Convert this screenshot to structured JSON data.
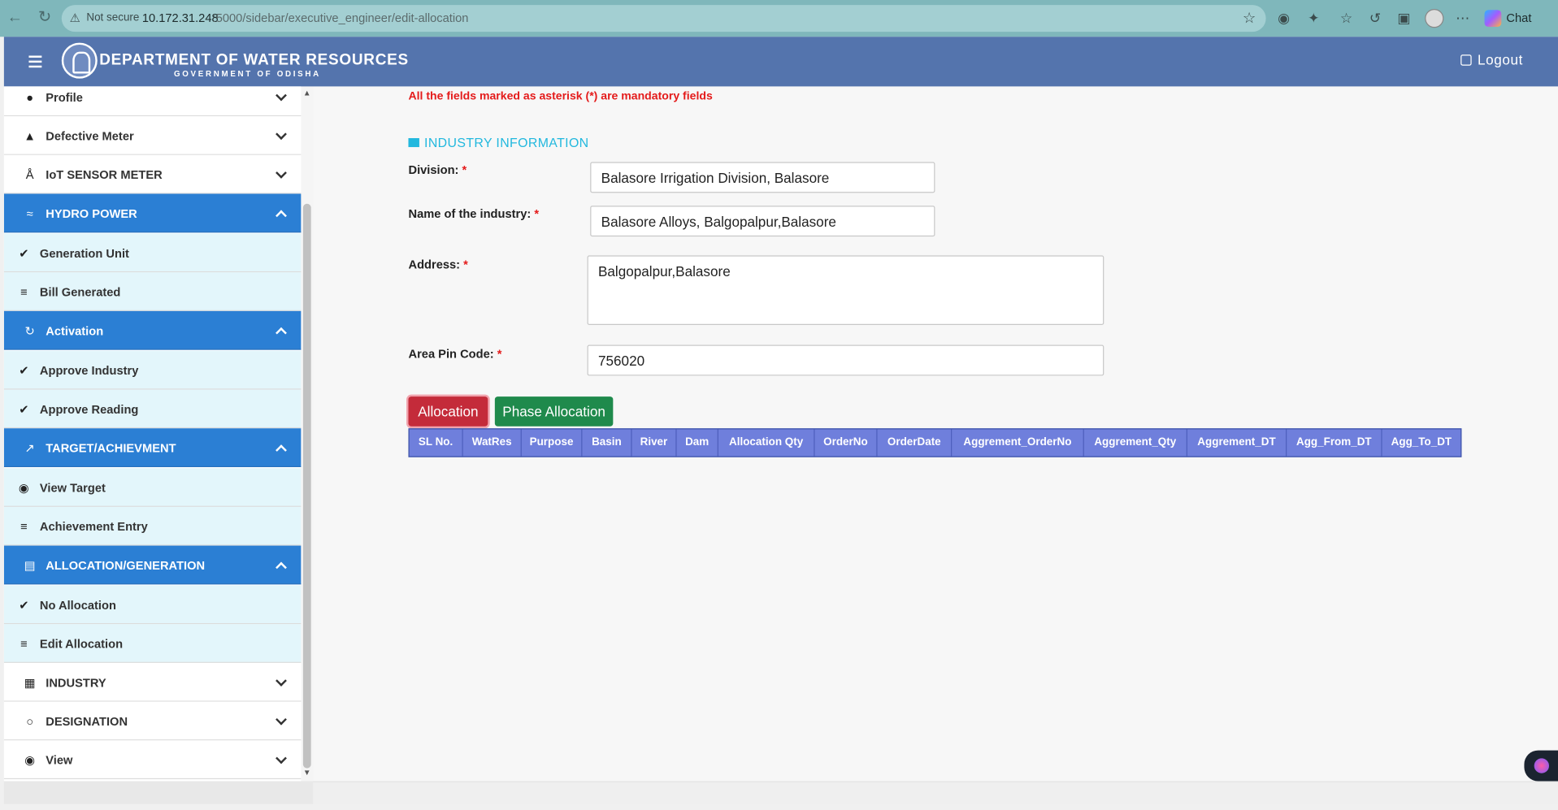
{
  "browser": {
    "not_secure": "Not secure",
    "url_host": "10.172.31.248",
    "url_path": ":5000/sidebar/executive_engineer/edit-allocation",
    "chat_label": "Chat"
  },
  "header": {
    "title": "DEPARTMENT OF WATER RESOURCES",
    "subtitle": "GOVERNMENT OF ODISHA",
    "logout": "Logout"
  },
  "sidebar": {
    "items": [
      {
        "label": "Profile"
      },
      {
        "label": "Defective Meter"
      },
      {
        "label": "IoT SENSOR METER"
      },
      {
        "label": "HYDRO POWER"
      },
      {
        "label": "Generation Unit"
      },
      {
        "label": "Bill Generated"
      },
      {
        "label": "Activation"
      },
      {
        "label": "Approve Industry"
      },
      {
        "label": "Approve Reading"
      },
      {
        "label": "TARGET/ACHIEVMENT"
      },
      {
        "label": "View Target"
      },
      {
        "label": "Achievement Entry"
      },
      {
        "label": "ALLOCATION/GENERATION"
      },
      {
        "label": "No Allocation"
      },
      {
        "label": "Edit Allocation"
      },
      {
        "label": "INDUSTRY"
      },
      {
        "label": "DESIGNATION"
      },
      {
        "label": "View"
      }
    ]
  },
  "main": {
    "mandatory_note": "All the fields marked as asterisk (*) are mandatory fields",
    "section_title": "INDUSTRY INFORMATION",
    "fields": {
      "division_label": "Division:",
      "division_value": "Balasore Irrigation Division, Balasore",
      "industry_label": "Name of the industry:",
      "industry_value": "Balasore Alloys, Balgopalpur,Balasore",
      "address_label": "Address:",
      "address_value": "Balgopalpur,Balasore",
      "pin_label": "Area Pin Code:",
      "pin_value": "756020",
      "asterisk": "*"
    },
    "buttons": {
      "allocation": "Allocation",
      "phase_allocation": "Phase Allocation"
    },
    "table_headers": [
      "SL No.",
      "WatRes",
      "Purpose",
      "Basin",
      "River",
      "Dam",
      "Allocation Qty",
      "OrderNo",
      "OrderDate",
      "Aggrement_OrderNo",
      "Aggrement_Qty",
      "Aggrement_DT",
      "Agg_From_DT",
      "Agg_To_DT"
    ]
  },
  "colors": {
    "header": "#5474ad",
    "sidebar_active": "#2b7fd4",
    "sidebar_child": "#e3f6fb",
    "mandatory_text": "#e41b1b",
    "section_title": "#22b8de",
    "btn_allocation": "#c42b3a",
    "btn_phase": "#1f8a4c",
    "table_header": "#6f7fdc"
  }
}
